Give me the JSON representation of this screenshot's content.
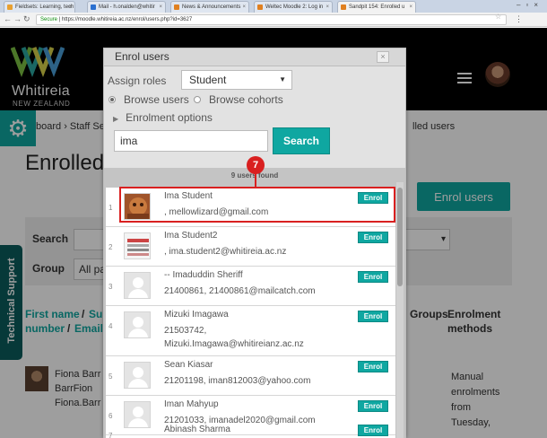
{
  "browser": {
    "tabs": [
      {
        "label": "Fieldsets: Learning, tech",
        "color": "#e8a030"
      },
      {
        "label": "Mail - h.onalden@whitir",
        "color": "#2a6fd0"
      },
      {
        "label": "News & Announcements",
        "color": "#e08020"
      },
      {
        "label": "Weltec Moodle 2: Log in",
        "color": "#e08020"
      },
      {
        "label": "Sandpit 154: Enrolled u",
        "color": "#e08020"
      }
    ],
    "url_secure": "Secure",
    "url": "https://moodle.whitireia.ac.nz/enrol/users.php?id=3627"
  },
  "site": {
    "logo_name": "Whitireia",
    "logo_sub": "NEW ZEALAND"
  },
  "breadcrumb": {
    "left": "board  ›  Staff Se",
    "right": "lled users"
  },
  "page": {
    "title": "Enrolled",
    "enrol_button": "Enrol users",
    "search_label": "Search",
    "group_label": "Group",
    "group_value": "All pa"
  },
  "technical_support": "Technical Support",
  "columns": {
    "first_name": "First name",
    "slash1": "/",
    "surname": "Sur",
    "number": "number",
    "slash2": "/",
    "email": "Email",
    "groups": "Groups",
    "enrol_methods_1": "Enrolment",
    "enrol_methods_2": "methods"
  },
  "bg_user": {
    "line1": "Fiona Barr",
    "line2": "BarrFion",
    "line3": "Fiona.Barr"
  },
  "bg_method": [
    "Manual",
    "enrolments",
    "from",
    "Tuesday,"
  ],
  "dialog": {
    "title": "Enrol users",
    "assign_roles_label": "Assign roles",
    "role_value": "Student",
    "browse_users": "Browse users",
    "browse_cohorts": "Browse cohorts",
    "enrolment_options": "Enrolment options",
    "search_value": "ima",
    "search_button": "Search",
    "users_found": "9 users found",
    "enrol_label": "Enrol",
    "users": [
      {
        "num": "1",
        "name": "Ima Student",
        "detail": ", mellowlizard@gmail.com",
        "photo": "custom1"
      },
      {
        "num": "2",
        "name": "Ima Student2",
        "detail": ", ima.student2@whitireia.ac.nz",
        "photo": "custom2"
      },
      {
        "num": "3",
        "name": "-- Imaduddin Sheriff",
        "detail": "21400861, 21400861@mailcatch.com",
        "photo": "default"
      },
      {
        "num": "4",
        "name": "Mizuki Imagawa",
        "detail": "21503742,",
        "detail2": "Mizuki.Imagawa@whitireianz.ac.nz",
        "photo": "default"
      },
      {
        "num": "5",
        "name": "Sean Kiasar",
        "detail": "21201198, iman812003@yahoo.com",
        "photo": "default"
      },
      {
        "num": "6",
        "name": "Iman Mahyup",
        "detail": "21201033, imanadel2020@gmail.com",
        "photo": "default"
      },
      {
        "num": "7",
        "name": "Abinash Sharma",
        "detail": "",
        "photo": "default"
      }
    ]
  },
  "annotation": {
    "step": "7",
    "color": "#d92020"
  },
  "colors": {
    "accent": "#0fa7a1",
    "support_tab": "#0a5c5c"
  }
}
